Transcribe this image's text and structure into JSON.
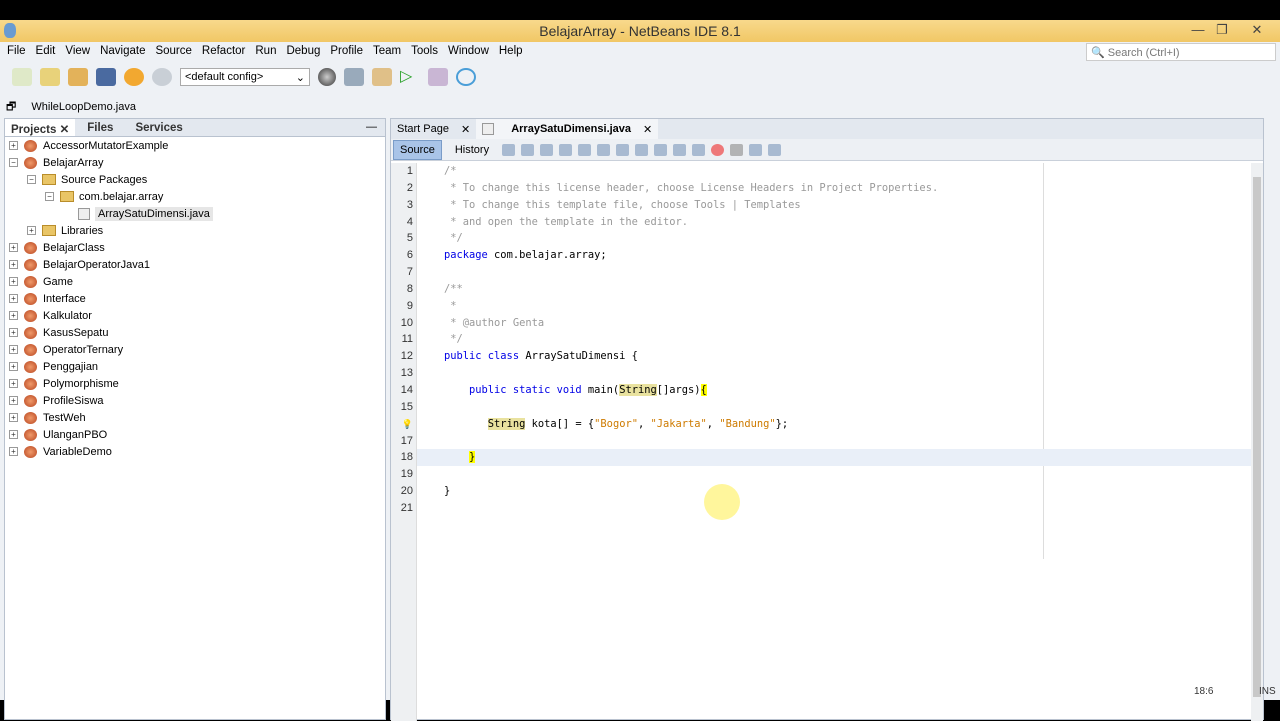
{
  "window": {
    "title": "BelajarArray - NetBeans IDE 8.1",
    "min": "—",
    "restore": "❐",
    "close": "✕"
  },
  "menu": [
    "File",
    "Edit",
    "View",
    "Navigate",
    "Source",
    "Refactor",
    "Run",
    "Debug",
    "Profile",
    "Team",
    "Tools",
    "Window",
    "Help"
  ],
  "search_placeholder": "Search (Ctrl+I)",
  "toolbar": {
    "config": "<default config>"
  },
  "pinned_file": "WhileLoopDemo.java",
  "left_tabs": [
    "Projects",
    "Files",
    "Services"
  ],
  "tree": [
    {
      "label": "AccessorMutatorExample",
      "level": 0,
      "type": "project",
      "exp": "+"
    },
    {
      "label": "BelajarArray",
      "level": 0,
      "type": "project",
      "exp": "−"
    },
    {
      "label": "Source Packages",
      "level": 1,
      "type": "folder",
      "exp": "−"
    },
    {
      "label": "com.belajar.array",
      "level": 2,
      "type": "package",
      "exp": "−"
    },
    {
      "label": "ArraySatuDimensi.java",
      "level": 3,
      "type": "java",
      "exp": ""
    },
    {
      "label": "Libraries",
      "level": 1,
      "type": "folder",
      "exp": "+"
    },
    {
      "label": "BelajarClass",
      "level": 0,
      "type": "project",
      "exp": "+"
    },
    {
      "label": "BelajarOperatorJava1",
      "level": 0,
      "type": "project",
      "exp": "+"
    },
    {
      "label": "Game",
      "level": 0,
      "type": "project",
      "exp": "+"
    },
    {
      "label": "Interface",
      "level": 0,
      "type": "project",
      "exp": "+"
    },
    {
      "label": "Kalkulator",
      "level": 0,
      "type": "project",
      "exp": "+"
    },
    {
      "label": "KasusSepatu",
      "level": 0,
      "type": "project",
      "exp": "+"
    },
    {
      "label": "OperatorTernary",
      "level": 0,
      "type": "project",
      "exp": "+"
    },
    {
      "label": "Penggajian",
      "level": 0,
      "type": "project",
      "exp": "+"
    },
    {
      "label": "Polymorphisme",
      "level": 0,
      "type": "project",
      "exp": "+"
    },
    {
      "label": "ProfileSiswa",
      "level": 0,
      "type": "project",
      "exp": "+"
    },
    {
      "label": "TestWeh",
      "level": 0,
      "type": "project",
      "exp": "+"
    },
    {
      "label": "UlanganPBO",
      "level": 0,
      "type": "project",
      "exp": "+"
    },
    {
      "label": "VariableDemo",
      "level": 0,
      "type": "project",
      "exp": "+"
    }
  ],
  "editor_tabs": [
    "Start Page",
    "ArraySatuDimensi.java"
  ],
  "editor_modes": [
    "Source",
    "History"
  ],
  "code": [
    "<span class=cm>/*</span>",
    "<span class=cm> * To change this license header, choose License Headers in Project Properties.</span>",
    "<span class=cm> * To change this template file, choose Tools | Templates</span>",
    "<span class=cm> * and open the template in the editor.</span>",
    "<span class=cm> */</span>",
    "<span class=kw>package</span> com.belajar.array;",
    "",
    "<span class=cm>/**</span>",
    "<span class=cm> *</span>",
    "<span class=cm> * @author Genta</span>",
    "<span class=cm> */</span>",
    "<span class=kw>public class</span> ArraySatuDimensi {",
    "",
    "    <span class=kw>public static void</span> main(<span class=hl>String</span>[]args)<span class=br>{</span>",
    "",
    "       <span class=hl>String</span> kota[] = {<span class=str>\"Bogor\"</span>, <span class=str>\"Jakarta\"</span>, <span class=str>\"Bandung\"</span>};",
    "",
    "    <span class=br>}</span>",
    "",
    "}",
    ""
  ],
  "status": {
    "position": "18:6",
    "mode": "INS"
  }
}
